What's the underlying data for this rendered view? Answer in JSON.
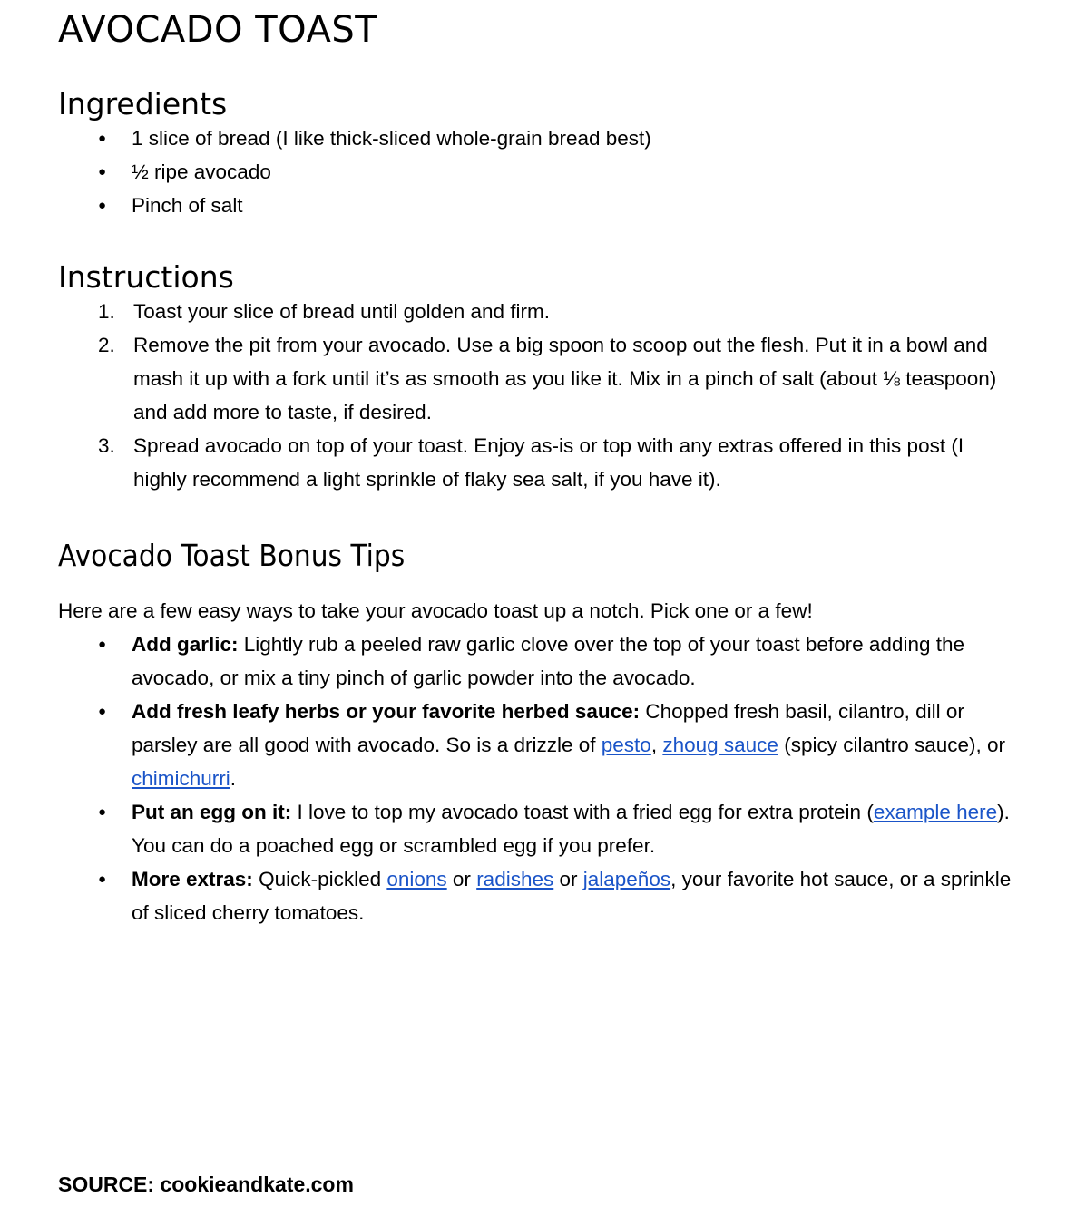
{
  "document": {
    "title": "AVOCADO TOAST"
  },
  "ingredients": {
    "heading": "Ingredients",
    "items": [
      "1 slice of bread (I like thick-sliced whole-grain bread best)",
      "½ ripe avocado",
      "Pinch of salt"
    ]
  },
  "instructions": {
    "heading": "Instructions",
    "steps": [
      "Toast your slice of bread until golden and firm.",
      "Remove the pit from your avocado. Use a big spoon to scoop out the flesh. Put it in a bowl and mash it up with a fork until it’s as smooth as you like it. Mix in a pinch of salt (about ⅛ teaspoon) and add more to taste, if desired.",
      "Spread avocado on top of your toast. Enjoy as-is or top with any extras offered in this post (I highly recommend a light sprinkle of flaky sea salt, if you have it)."
    ]
  },
  "bonus_tips": {
    "heading": "Avocado Toast Bonus Tips",
    "intro": "Here are a few easy ways to take your avocado toast up a notch. Pick one or a few!",
    "tips": [
      {
        "lead_in": "Add garlic:",
        "text_1": " Lightly rub a peeled raw garlic clove over the top of your toast before adding the avocado, or mix a tiny pinch of garlic powder into the avocado."
      },
      {
        "lead_in": "Add fresh leafy herbs or your favorite herbed sauce:",
        "text_1": " Chopped fresh basil, cilantro, dill or parsley are all good with avocado. So is a drizzle of ",
        "link_1": "pesto",
        "text_2": ", ",
        "link_2": "zhoug sauce",
        "text_3": " (spicy cilantro sauce), or ",
        "link_3": "chimichurri",
        "text_4": "."
      },
      {
        "lead_in": "Put an egg on it:",
        "text_1": " I love to top my avocado toast with a fried egg for extra protein (",
        "link_1": "example here",
        "text_2": "). You can do a poached egg or scrambled egg if you prefer."
      },
      {
        "lead_in": "More extras:",
        "text_1": " Quick-pickled ",
        "link_1": "onions",
        "text_2": " or ",
        "link_2": "radishes",
        "text_3": " or ",
        "link_3": "jalapeños",
        "text_4": ", your favorite hot sauce, or a sprinkle of sliced cherry tomatoes."
      }
    ]
  },
  "footer": {
    "source": "SOURCE: cookieandkate.com"
  },
  "colors": {
    "text": "#000000",
    "link": "#1a54c8",
    "background": "#ffffff"
  }
}
